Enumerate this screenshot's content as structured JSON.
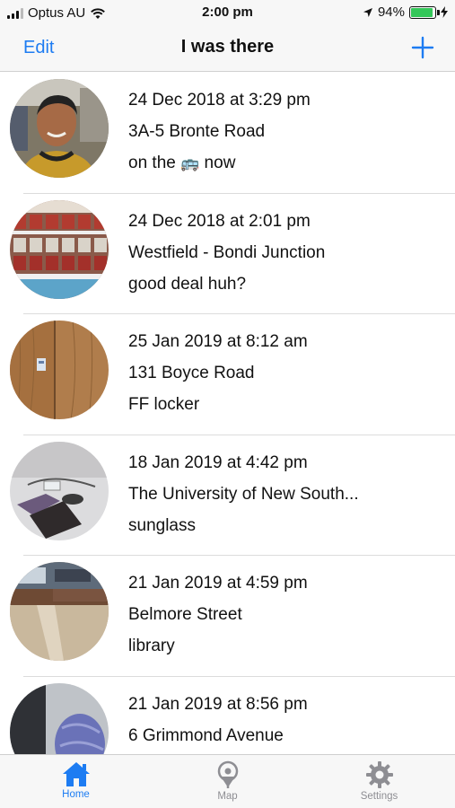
{
  "status_bar": {
    "carrier": "Optus AU",
    "time": "2:00 pm",
    "battery": "94%",
    "battery_level": 0.94
  },
  "nav": {
    "edit_label": "Edit",
    "title": "I was there",
    "add_icon": "plus-icon"
  },
  "entries": [
    {
      "date": "24 Dec 2018 at 3:29 pm",
      "place": "3A-5 Bronte Road",
      "note_before": "on the ",
      "note_emoji": "🚌",
      "note_after": " now",
      "photo": "selfie-photo"
    },
    {
      "date": "24 Dec 2018 at 2:01 pm",
      "place": "Westfield - Bondi Junction",
      "note": "good deal huh?",
      "photo": "store-shelf-photo"
    },
    {
      "date": "25 Jan 2019 at 8:12 am",
      "place": "131 Boyce Road",
      "note": "FF locker",
      "photo": "wooden-locker-photo"
    },
    {
      "date": "18 Jan 2019 at 4:42 pm",
      "place": "The University of New South...",
      "note": "sunglass",
      "photo": "desk-sunglasses-photo"
    },
    {
      "date": "21 Jan 2019 at 4:59 pm",
      "place": "Belmore Street",
      "note": "library",
      "photo": "library-floor-photo"
    },
    {
      "date": "21 Jan 2019 at 8:56 pm",
      "place": "6 Grimmond Avenue",
      "note": "",
      "photo": "bag-photo"
    }
  ],
  "tabs": [
    {
      "label": "Home",
      "icon": "home-icon",
      "selected": true
    },
    {
      "label": "Map",
      "icon": "map-pin-icon",
      "selected": false
    },
    {
      "label": "Settings",
      "icon": "gear-icon",
      "selected": false
    }
  ],
  "colors": {
    "accent": "#1d7cf2",
    "inactive": "#8e8e93",
    "battery": "#34c759"
  }
}
